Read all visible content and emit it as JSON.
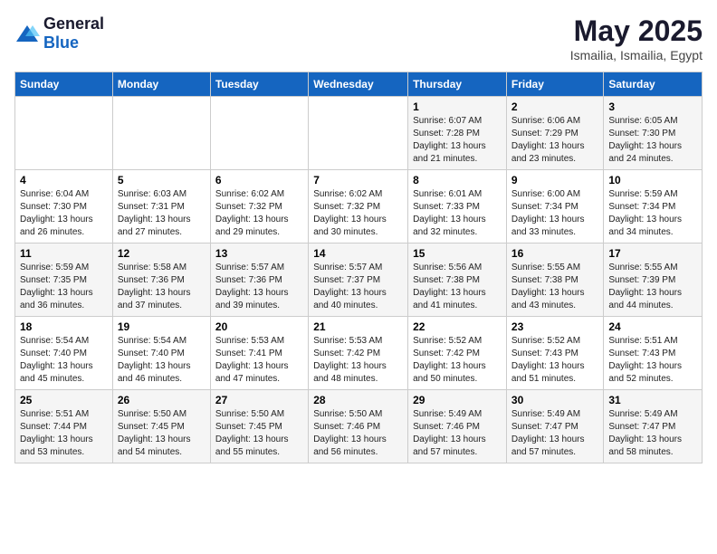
{
  "logo": {
    "general": "General",
    "blue": "Blue"
  },
  "title": "May 2025",
  "subtitle": "Ismailia, Ismailia, Egypt",
  "days_of_week": [
    "Sunday",
    "Monday",
    "Tuesday",
    "Wednesday",
    "Thursday",
    "Friday",
    "Saturday"
  ],
  "weeks": [
    [
      {
        "day": "",
        "detail": ""
      },
      {
        "day": "",
        "detail": ""
      },
      {
        "day": "",
        "detail": ""
      },
      {
        "day": "",
        "detail": ""
      },
      {
        "day": "1",
        "detail": "Sunrise: 6:07 AM\nSunset: 7:28 PM\nDaylight: 13 hours and 21 minutes."
      },
      {
        "day": "2",
        "detail": "Sunrise: 6:06 AM\nSunset: 7:29 PM\nDaylight: 13 hours and 23 minutes."
      },
      {
        "day": "3",
        "detail": "Sunrise: 6:05 AM\nSunset: 7:30 PM\nDaylight: 13 hours and 24 minutes."
      }
    ],
    [
      {
        "day": "4",
        "detail": "Sunrise: 6:04 AM\nSunset: 7:30 PM\nDaylight: 13 hours and 26 minutes."
      },
      {
        "day": "5",
        "detail": "Sunrise: 6:03 AM\nSunset: 7:31 PM\nDaylight: 13 hours and 27 minutes."
      },
      {
        "day": "6",
        "detail": "Sunrise: 6:02 AM\nSunset: 7:32 PM\nDaylight: 13 hours and 29 minutes."
      },
      {
        "day": "7",
        "detail": "Sunrise: 6:02 AM\nSunset: 7:32 PM\nDaylight: 13 hours and 30 minutes."
      },
      {
        "day": "8",
        "detail": "Sunrise: 6:01 AM\nSunset: 7:33 PM\nDaylight: 13 hours and 32 minutes."
      },
      {
        "day": "9",
        "detail": "Sunrise: 6:00 AM\nSunset: 7:34 PM\nDaylight: 13 hours and 33 minutes."
      },
      {
        "day": "10",
        "detail": "Sunrise: 5:59 AM\nSunset: 7:34 PM\nDaylight: 13 hours and 34 minutes."
      }
    ],
    [
      {
        "day": "11",
        "detail": "Sunrise: 5:59 AM\nSunset: 7:35 PM\nDaylight: 13 hours and 36 minutes."
      },
      {
        "day": "12",
        "detail": "Sunrise: 5:58 AM\nSunset: 7:36 PM\nDaylight: 13 hours and 37 minutes."
      },
      {
        "day": "13",
        "detail": "Sunrise: 5:57 AM\nSunset: 7:36 PM\nDaylight: 13 hours and 39 minutes."
      },
      {
        "day": "14",
        "detail": "Sunrise: 5:57 AM\nSunset: 7:37 PM\nDaylight: 13 hours and 40 minutes."
      },
      {
        "day": "15",
        "detail": "Sunrise: 5:56 AM\nSunset: 7:38 PM\nDaylight: 13 hours and 41 minutes."
      },
      {
        "day": "16",
        "detail": "Sunrise: 5:55 AM\nSunset: 7:38 PM\nDaylight: 13 hours and 43 minutes."
      },
      {
        "day": "17",
        "detail": "Sunrise: 5:55 AM\nSunset: 7:39 PM\nDaylight: 13 hours and 44 minutes."
      }
    ],
    [
      {
        "day": "18",
        "detail": "Sunrise: 5:54 AM\nSunset: 7:40 PM\nDaylight: 13 hours and 45 minutes."
      },
      {
        "day": "19",
        "detail": "Sunrise: 5:54 AM\nSunset: 7:40 PM\nDaylight: 13 hours and 46 minutes."
      },
      {
        "day": "20",
        "detail": "Sunrise: 5:53 AM\nSunset: 7:41 PM\nDaylight: 13 hours and 47 minutes."
      },
      {
        "day": "21",
        "detail": "Sunrise: 5:53 AM\nSunset: 7:42 PM\nDaylight: 13 hours and 48 minutes."
      },
      {
        "day": "22",
        "detail": "Sunrise: 5:52 AM\nSunset: 7:42 PM\nDaylight: 13 hours and 50 minutes."
      },
      {
        "day": "23",
        "detail": "Sunrise: 5:52 AM\nSunset: 7:43 PM\nDaylight: 13 hours and 51 minutes."
      },
      {
        "day": "24",
        "detail": "Sunrise: 5:51 AM\nSunset: 7:43 PM\nDaylight: 13 hours and 52 minutes."
      }
    ],
    [
      {
        "day": "25",
        "detail": "Sunrise: 5:51 AM\nSunset: 7:44 PM\nDaylight: 13 hours and 53 minutes."
      },
      {
        "day": "26",
        "detail": "Sunrise: 5:50 AM\nSunset: 7:45 PM\nDaylight: 13 hours and 54 minutes."
      },
      {
        "day": "27",
        "detail": "Sunrise: 5:50 AM\nSunset: 7:45 PM\nDaylight: 13 hours and 55 minutes."
      },
      {
        "day": "28",
        "detail": "Sunrise: 5:50 AM\nSunset: 7:46 PM\nDaylight: 13 hours and 56 minutes."
      },
      {
        "day": "29",
        "detail": "Sunrise: 5:49 AM\nSunset: 7:46 PM\nDaylight: 13 hours and 57 minutes."
      },
      {
        "day": "30",
        "detail": "Sunrise: 5:49 AM\nSunset: 7:47 PM\nDaylight: 13 hours and 57 minutes."
      },
      {
        "day": "31",
        "detail": "Sunrise: 5:49 AM\nSunset: 7:47 PM\nDaylight: 13 hours and 58 minutes."
      }
    ]
  ]
}
